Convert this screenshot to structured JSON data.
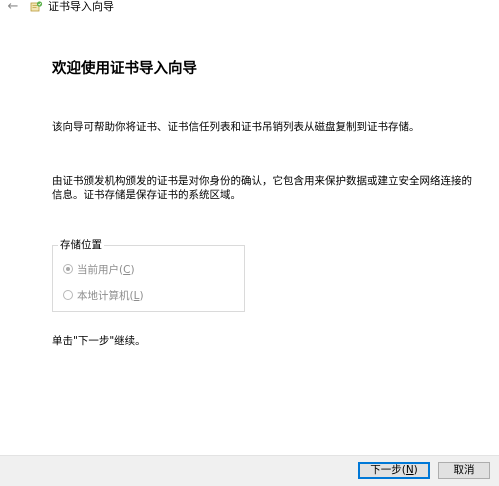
{
  "window": {
    "title": "证书导入向导",
    "back_icon": "back-arrow-icon",
    "app_icon": "certificate-wizard-icon"
  },
  "main": {
    "heading": "欢迎使用证书导入向导",
    "intro": "该向导可帮助你将证书、证书信任列表和证书吊销列表从磁盘复制到证书存储。",
    "description": "由证书颁发机构颁发的证书是对你身份的确认，它包含用来保护数据或建立安全网络连接的信息。证书存储是保存证书的系统区域。",
    "store_location": {
      "legend": "存储位置",
      "options": [
        {
          "label": "当前用户(",
          "mnemonic": "C",
          "suffix": ")",
          "selected": true,
          "enabled": false
        },
        {
          "label": "本地计算机(",
          "mnemonic": "L",
          "suffix": ")",
          "selected": false,
          "enabled": false
        }
      ]
    },
    "continue_hint": "单击\"下一步\"继续。"
  },
  "footer": {
    "next_label": "下一步(",
    "next_mnemonic": "N",
    "next_suffix": ")",
    "cancel_label": "取消"
  },
  "colors": {
    "accent": "#0078d7",
    "footer_bg": "#f0f0f0",
    "disabled_text": "#8d8d8d"
  }
}
